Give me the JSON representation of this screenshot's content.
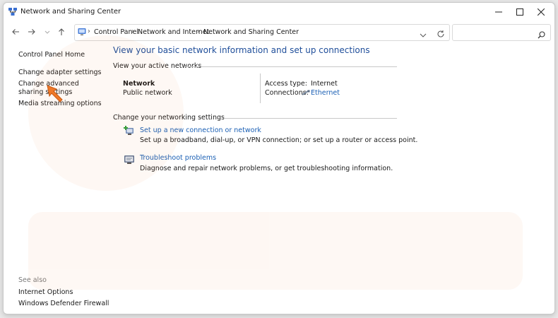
{
  "window": {
    "title": "Network and Sharing Center",
    "icon": "network-center-icon"
  },
  "nav": {
    "breadcrumb": [
      "Control Panel",
      "Network and Internet",
      "Network and Sharing Center"
    ],
    "search_placeholder": ""
  },
  "sidebar": {
    "home": "Control Panel Home",
    "items": [
      "Change adapter settings",
      "Change advanced sharing settings",
      "Media streaming options"
    ],
    "see_also_label": "See also",
    "see_also": [
      "Internet Options",
      "Windows Defender Firewall"
    ]
  },
  "main": {
    "heading": "View your basic network information and set up connections",
    "active_networks_label": "View your active networks",
    "network": {
      "name": "Network",
      "type": "Public network",
      "access_type_label": "Access type:",
      "access_type": "Internet",
      "connections_label": "Connections:",
      "connection": "Ethernet"
    },
    "change_settings_label": "Change your networking settings",
    "tasks": [
      {
        "title": "Set up a new connection or network",
        "desc": "Set up a broadband, dial-up, or VPN connection; or set up a router or access point.",
        "icon": "new-connection-icon"
      },
      {
        "title": "Troubleshoot problems",
        "desc": "Diagnose and repair network problems, or get troubleshooting information.",
        "icon": "troubleshoot-icon"
      }
    ]
  },
  "colors": {
    "link": "#1a5fb4",
    "heading": "#1f4e9a",
    "cursor": "#f07a2a"
  }
}
